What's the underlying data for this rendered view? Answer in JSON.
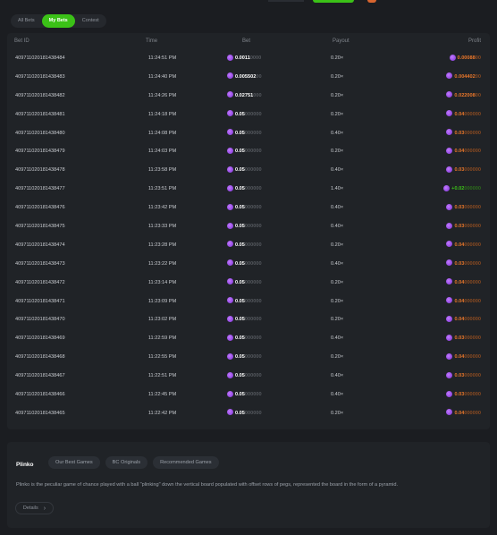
{
  "tabs": [
    {
      "label": "All Bets",
      "active": false
    },
    {
      "label": "My Bets",
      "active": true
    },
    {
      "label": "Contest",
      "active": false
    }
  ],
  "table": {
    "headers": {
      "bet_id": "Bet ID",
      "time": "Time",
      "bet": "Bet",
      "payout": "Payout",
      "profit": "Profit"
    },
    "rows": [
      {
        "id": "409711020181438484",
        "time": "11:24:51 PM",
        "bet_main": "0.0011",
        "bet_dim": "0000",
        "payout": "0.20×",
        "profit_main": "0.00088",
        "profit_dim": "00",
        "result": "lose"
      },
      {
        "id": "409711020181438483",
        "time": "11:24:40 PM",
        "bet_main": "0.005502",
        "bet_dim": "00",
        "payout": "0.20×",
        "profit_main": "0.004402",
        "profit_dim": "00",
        "result": "lose"
      },
      {
        "id": "409711020181438482",
        "time": "11:24:26 PM",
        "bet_main": "0.02751",
        "bet_dim": "000",
        "payout": "0.20×",
        "profit_main": "0.022008",
        "profit_dim": "00",
        "result": "lose"
      },
      {
        "id": "409711020181438481",
        "time": "11:24:18 PM",
        "bet_main": "0.05",
        "bet_dim": "000000",
        "payout": "0.20×",
        "profit_main": "0.04",
        "profit_dim": "000000",
        "result": "lose"
      },
      {
        "id": "409711020181438480",
        "time": "11:24:08 PM",
        "bet_main": "0.05",
        "bet_dim": "000000",
        "payout": "0.40×",
        "profit_main": "0.03",
        "profit_dim": "000000",
        "result": "lose"
      },
      {
        "id": "409711020181438479",
        "time": "11:24:03 PM",
        "bet_main": "0.05",
        "bet_dim": "000000",
        "payout": "0.20×",
        "profit_main": "0.04",
        "profit_dim": "000000",
        "result": "lose"
      },
      {
        "id": "409711020181438478",
        "time": "11:23:58 PM",
        "bet_main": "0.05",
        "bet_dim": "000000",
        "payout": "0.40×",
        "profit_main": "0.03",
        "profit_dim": "000000",
        "result": "lose"
      },
      {
        "id": "409711020181438477",
        "time": "11:23:51 PM",
        "bet_main": "0.05",
        "bet_dim": "000000",
        "payout": "1.40×",
        "profit_main": "+0.02",
        "profit_dim": "000000",
        "result": "win"
      },
      {
        "id": "409711020181438476",
        "time": "11:23:42 PM",
        "bet_main": "0.05",
        "bet_dim": "000000",
        "payout": "0.40×",
        "profit_main": "0.03",
        "profit_dim": "000000",
        "result": "lose"
      },
      {
        "id": "409711020181438475",
        "time": "11:23:33 PM",
        "bet_main": "0.05",
        "bet_dim": "000000",
        "payout": "0.40×",
        "profit_main": "0.03",
        "profit_dim": "000000",
        "result": "lose"
      },
      {
        "id": "409711020181438474",
        "time": "11:23:28 PM",
        "bet_main": "0.05",
        "bet_dim": "000000",
        "payout": "0.20×",
        "profit_main": "0.04",
        "profit_dim": "000000",
        "result": "lose"
      },
      {
        "id": "409711020181438473",
        "time": "11:23:22 PM",
        "bet_main": "0.05",
        "bet_dim": "000000",
        "payout": "0.40×",
        "profit_main": "0.03",
        "profit_dim": "000000",
        "result": "lose"
      },
      {
        "id": "409711020181438472",
        "time": "11:23:14 PM",
        "bet_main": "0.05",
        "bet_dim": "000000",
        "payout": "0.20×",
        "profit_main": "0.04",
        "profit_dim": "000000",
        "result": "lose"
      },
      {
        "id": "409711020181438471",
        "time": "11:23:09 PM",
        "bet_main": "0.05",
        "bet_dim": "000000",
        "payout": "0.20×",
        "profit_main": "0.04",
        "profit_dim": "000000",
        "result": "lose"
      },
      {
        "id": "409711020181438470",
        "time": "11:23:02 PM",
        "bet_main": "0.05",
        "bet_dim": "000000",
        "payout": "0.20×",
        "profit_main": "0.04",
        "profit_dim": "000000",
        "result": "lose"
      },
      {
        "id": "409711020181438469",
        "time": "11:22:59 PM",
        "bet_main": "0.05",
        "bet_dim": "000000",
        "payout": "0.40×",
        "profit_main": "0.03",
        "profit_dim": "000000",
        "result": "lose"
      },
      {
        "id": "409711020181438468",
        "time": "11:22:55 PM",
        "bet_main": "0.05",
        "bet_dim": "000000",
        "payout": "0.20×",
        "profit_main": "0.04",
        "profit_dim": "000000",
        "result": "lose"
      },
      {
        "id": "409711020181438467",
        "time": "11:22:51 PM",
        "bet_main": "0.05",
        "bet_dim": "000000",
        "payout": "0.40×",
        "profit_main": "0.03",
        "profit_dim": "000000",
        "result": "lose"
      },
      {
        "id": "409711020181438466",
        "time": "11:22:45 PM",
        "bet_main": "0.05",
        "bet_dim": "000000",
        "payout": "0.40×",
        "profit_main": "0.03",
        "profit_dim": "000000",
        "result": "lose"
      },
      {
        "id": "409711020181438465",
        "time": "11:22:42 PM",
        "bet_main": "0.05",
        "bet_dim": "000000",
        "payout": "0.20×",
        "profit_main": "0.04",
        "profit_dim": "000000",
        "result": "lose"
      }
    ]
  },
  "info": {
    "title": "Plinko",
    "chips": [
      "Our Best Games",
      "BC Originals",
      "Recommended Games"
    ],
    "description": "Plinko is the peculiar game of chance played with a ball \"plinking\" down the vertical board populated with offset rows of pegs, represented the board in the form of a pyramid.",
    "details_label": "Details"
  },
  "colors": {
    "accent": "#3bc117",
    "loss": "#e8762a",
    "coin": "#9b4dff"
  },
  "icons": {
    "coin": "coin-icon",
    "details": "chevron-right-icon"
  }
}
